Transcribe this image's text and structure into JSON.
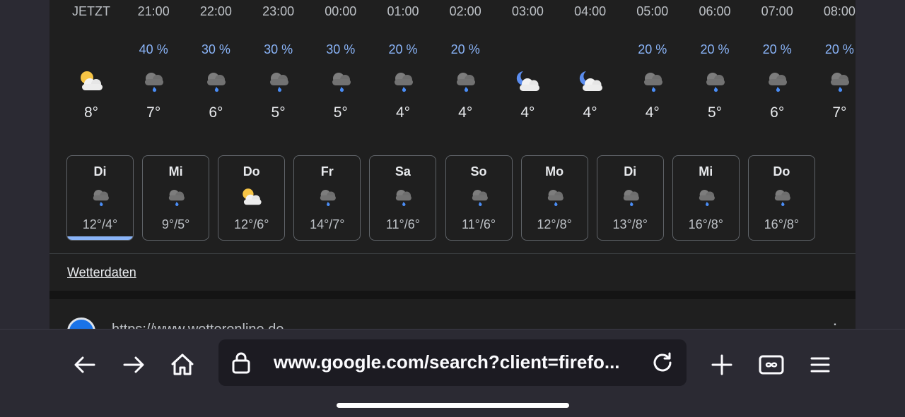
{
  "hourly": [
    {
      "time": "JETZT",
      "precip": "",
      "icon": "sun-cloud-icon",
      "temp": "8°"
    },
    {
      "time": "21:00",
      "precip": "40 %",
      "icon": "rain-cloud-icon",
      "temp": "7°"
    },
    {
      "time": "22:00",
      "precip": "30 %",
      "icon": "rain-cloud-icon",
      "temp": "6°"
    },
    {
      "time": "23:00",
      "precip": "30 %",
      "icon": "rain-cloud-icon",
      "temp": "5°"
    },
    {
      "time": "00:00",
      "precip": "30 %",
      "icon": "rain-cloud-icon",
      "temp": "5°"
    },
    {
      "time": "01:00",
      "precip": "20 %",
      "icon": "rain-cloud-icon",
      "temp": "4°"
    },
    {
      "time": "02:00",
      "precip": "20 %",
      "icon": "rain-cloud-icon",
      "temp": "4°"
    },
    {
      "time": "03:00",
      "precip": "",
      "icon": "moon-cloud-icon",
      "temp": "4°"
    },
    {
      "time": "04:00",
      "precip": "",
      "icon": "moon-cloud-icon",
      "temp": "4°"
    },
    {
      "time": "05:00",
      "precip": "20 %",
      "icon": "rain-cloud-icon",
      "temp": "4°"
    },
    {
      "time": "06:00",
      "precip": "20 %",
      "icon": "rain-cloud-icon",
      "temp": "5°"
    },
    {
      "time": "07:00",
      "precip": "20 %",
      "icon": "rain-cloud-icon",
      "temp": "6°"
    },
    {
      "time": "08:00",
      "precip": "20 %",
      "icon": "rain-cloud-icon",
      "temp": "7°"
    }
  ],
  "daily": [
    {
      "day": "Di",
      "icon": "rain-cloud-icon",
      "temps": "12°/4°",
      "selected": true
    },
    {
      "day": "Mi",
      "icon": "rain-cloud-icon",
      "temps": "9°/5°"
    },
    {
      "day": "Do",
      "icon": "sun-cloud-icon",
      "temps": "12°/6°"
    },
    {
      "day": "Fr",
      "icon": "rain-cloud-icon",
      "temps": "14°/7°"
    },
    {
      "day": "Sa",
      "icon": "rain-cloud-icon",
      "temps": "11°/6°"
    },
    {
      "day": "So",
      "icon": "rain-cloud-icon",
      "temps": "11°/6°"
    },
    {
      "day": "Mo",
      "icon": "rain-cloud-icon",
      "temps": "12°/8°"
    },
    {
      "day": "Di",
      "icon": "rain-cloud-icon",
      "temps": "13°/8°"
    },
    {
      "day": "Mi",
      "icon": "rain-cloud-icon",
      "temps": "16°/8°"
    },
    {
      "day": "Do",
      "icon": "rain-cloud-icon",
      "temps": "16°/8°"
    }
  ],
  "source_link": "Wetterdaten",
  "next_result": {
    "url_partial": "https://www.wetteronline.de",
    "menu": "⋮"
  },
  "toolbar": {
    "back_icon": "arrow-left-icon",
    "forward_icon": "arrow-right-icon",
    "home_icon": "home-icon",
    "url": "www.google.com/search?client=firefo...",
    "reload_icon": "reload-icon",
    "new_tab_icon": "plus-icon",
    "tabs_icon": "tabs-infinity-icon",
    "menu_icon": "hamburger-icon"
  },
  "colors": {
    "precip": "#8ab4f8",
    "selected_bar": "#8ab4f8",
    "page_bg": "#1f1f1f",
    "chrome_bg": "#2b2a33"
  }
}
